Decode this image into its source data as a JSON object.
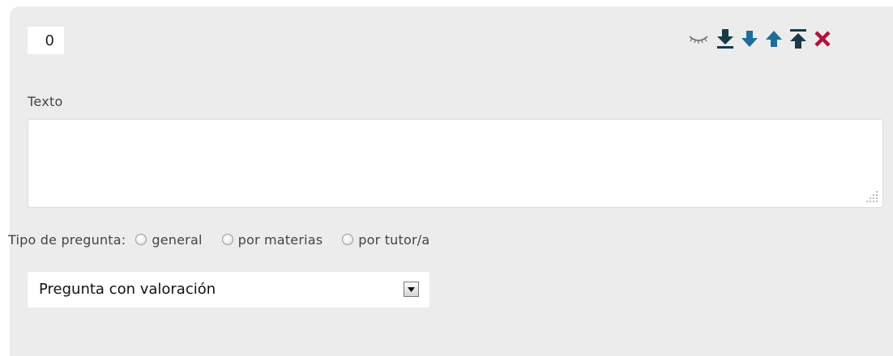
{
  "question": {
    "order_value": "0",
    "text_label": "Texto",
    "text_value": ""
  },
  "toolbar": {
    "icons": [
      "eye-closed-icon",
      "move-to-bottom-icon",
      "move-down-icon",
      "move-up-icon",
      "move-to-top-icon",
      "delete-icon"
    ],
    "colors": {
      "dark": "#1a3a4a",
      "blue": "#1f6e9a",
      "delete": "#b0123a",
      "eye": "#6f6f6f"
    }
  },
  "question_type": {
    "label": "Tipo de pregunta:",
    "options": [
      "general",
      "por materias",
      "por tutor/a"
    ]
  },
  "answer_type": {
    "selected": "Pregunta con valoración"
  },
  "colors": {
    "panel_bg": "#ececec",
    "field_bg": "#ffffff",
    "text": "#444444"
  }
}
